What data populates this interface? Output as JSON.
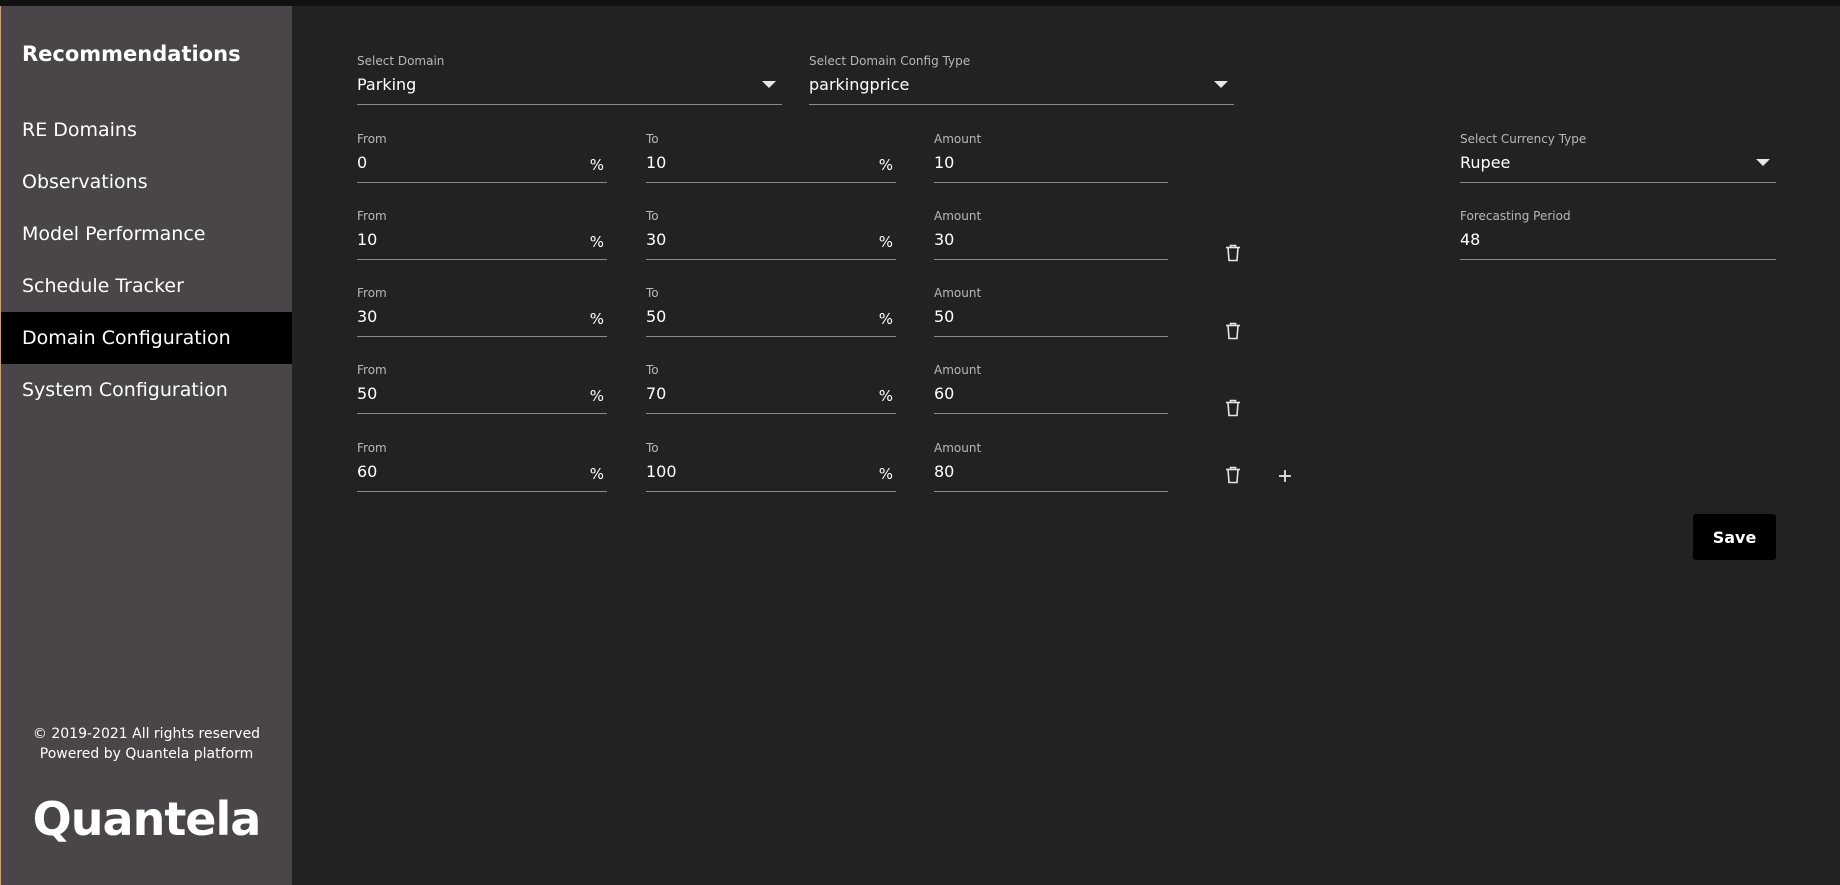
{
  "sidebar": {
    "title": "Recommendations",
    "items": [
      {
        "label": "RE Domains"
      },
      {
        "label": "Observations"
      },
      {
        "label": "Model Performance"
      },
      {
        "label": "Schedule Tracker"
      },
      {
        "label": "Domain Configuration",
        "active": true
      },
      {
        "label": "System Configuration"
      }
    ],
    "copyright": "© 2019-2021 All rights reserved",
    "powered_by": "Powered by Quantela platform",
    "logo": "Quantela"
  },
  "form": {
    "domain": {
      "label": "Select Domain",
      "value": "Parking"
    },
    "config_type": {
      "label": "Select Domain Config Type",
      "value": "parkingprice"
    },
    "currency": {
      "label": "Select Currency Type",
      "value": "Rupee"
    },
    "forecasting": {
      "label": "Forecasting Period",
      "value": "48"
    },
    "labels": {
      "from": "From",
      "to": "To",
      "amount": "Amount",
      "percent": "%"
    },
    "rows": [
      {
        "from": "0",
        "to": "10",
        "amount": "10"
      },
      {
        "from": "10",
        "to": "30",
        "amount": "30"
      },
      {
        "from": "30",
        "to": "50",
        "amount": "50"
      },
      {
        "from": "50",
        "to": "70",
        "amount": "60"
      },
      {
        "from": "60",
        "to": "100",
        "amount": "80"
      }
    ],
    "save_label": "Save"
  },
  "icons": {
    "delete": "trash-icon",
    "add": "plus-icon",
    "dropdown": "chevron-down-icon"
  },
  "colors": {
    "sidebar_bg": "#4a4549",
    "main_bg": "#222222",
    "active_nav": "#000000",
    "button_bg": "#000000"
  }
}
